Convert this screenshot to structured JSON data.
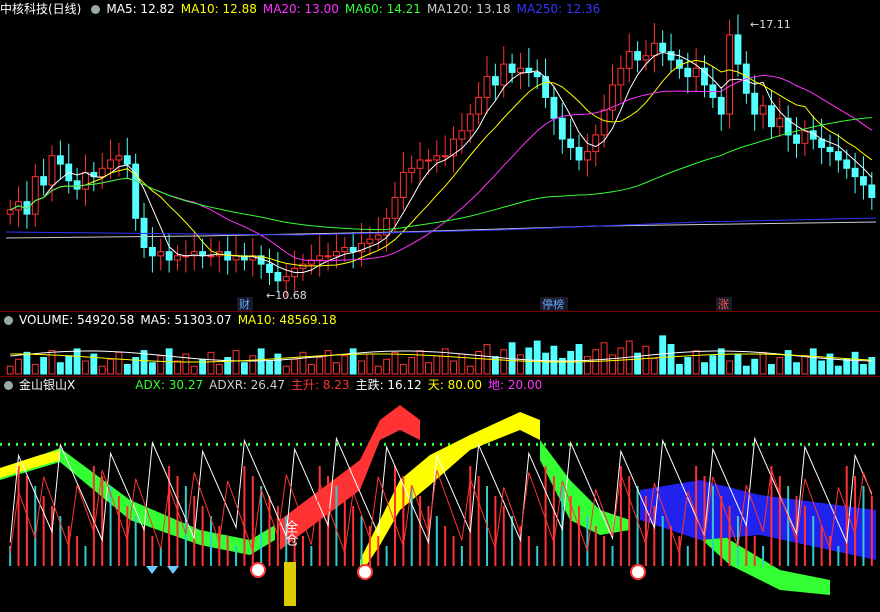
{
  "header": {
    "title": "中核科技(日线)",
    "ma": [
      {
        "label": "MA5: 12.82",
        "color": "#ffffff"
      },
      {
        "label": "MA10: 12.88",
        "color": "#ffff00"
      },
      {
        "label": "MA20: 13.00",
        "color": "#ff33ff"
      },
      {
        "label": "MA60: 14.21",
        "color": "#33ff33"
      },
      {
        "label": "MA120: 13.18",
        "color": "#cccccc"
      },
      {
        "label": "MA250: 12.36",
        "color": "#3333ff"
      }
    ]
  },
  "volume_header": [
    {
      "label": "VOLUME: 54920.58",
      "color": "#ffffff"
    },
    {
      "label": "MA5: 51303.07",
      "color": "#ffffff"
    },
    {
      "label": "MA10: 48569.18",
      "color": "#ffff00"
    }
  ],
  "indicator_header": {
    "name": "金山银山X",
    "items": [
      {
        "label": "ADX: 30.27",
        "color": "#33ff33"
      },
      {
        "label": "ADXR: 26.47",
        "color": "#cccccc"
      },
      {
        "label": "主升: 8.23",
        "color": "#ff3333"
      },
      {
        "label": "主跌: 16.12",
        "color": "#ffffff"
      },
      {
        "label": "天: 80.00",
        "color": "#ffff00"
      },
      {
        "label": "地: 20.00",
        "color": "#ff33ff"
      }
    ]
  },
  "annotations": {
    "high": "17.11",
    "low": "10.68",
    "tags": [
      {
        "text": "财",
        "color": "#66aaff"
      },
      {
        "text": "停榜",
        "color": "#66aaff"
      },
      {
        "text": "涨",
        "color": "#ff5555"
      }
    ],
    "full_position": "全仓"
  },
  "chart_data": {
    "type": "candlestick",
    "high_price": 17.11,
    "low_price": 10.68,
    "indicator_levels": {
      "sky": 80,
      "ground": 20
    }
  }
}
